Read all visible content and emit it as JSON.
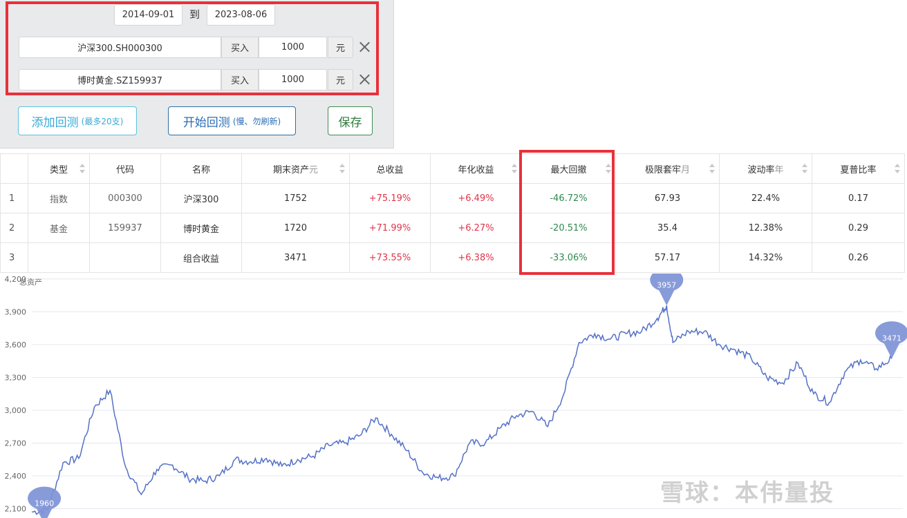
{
  "form": {
    "start_date": "2014-09-01",
    "to_label": "到",
    "end_date": "2023-08-06",
    "rows": [
      {
        "fund": "沪深300.SH000300",
        "action": "买入",
        "amount": "1000",
        "unit": "元"
      },
      {
        "fund": "博时黄金.SZ159937",
        "action": "买入",
        "amount": "1000",
        "unit": "元"
      }
    ],
    "add_label": "添加回测",
    "add_hint": "(最多20支)",
    "start_label": "开始回测",
    "start_hint": "(慢、勿刷新)",
    "save_label": "保存"
  },
  "table": {
    "headers": {
      "type": "类型",
      "code": "代码",
      "name": "名称",
      "final": "期末资产",
      "final_unit": "元",
      "total": "总收益",
      "annual": "年化收益",
      "maxdd": "最大回撤",
      "lock": "极限套牢",
      "lock_unit": "月",
      "vol": "波动率",
      "vol_unit": "年",
      "sharpe": "夏普比率"
    },
    "rows": [
      {
        "idx": "1",
        "type": "指数",
        "code": "000300",
        "name": "沪深300",
        "final": "1752",
        "total": "+75.19%",
        "annual": "+6.49%",
        "maxdd": "-46.72%",
        "lock": "67.93",
        "vol": "22.4%",
        "sharpe": "0.17"
      },
      {
        "idx": "2",
        "type": "基金",
        "code": "159937",
        "name": "博时黄金",
        "final": "1720",
        "total": "+71.99%",
        "annual": "+6.27%",
        "maxdd": "-20.51%",
        "lock": "35.4",
        "vol": "12.38%",
        "sharpe": "0.29"
      },
      {
        "idx": "3",
        "type": "",
        "code": "",
        "name": "组合收益",
        "final": "3471",
        "total": "+73.55%",
        "annual": "+6.38%",
        "maxdd": "-33.06%",
        "lock": "57.17",
        "vol": "14.32%",
        "sharpe": "0.26"
      }
    ]
  },
  "watermark": "雪球：本伟量投",
  "chart_data": {
    "type": "line",
    "ylabel": "总资产",
    "yticks": [
      2100,
      2400,
      2700,
      3000,
      3300,
      3600,
      3900,
      4200
    ],
    "ylim": [
      2015,
      4250
    ],
    "grid": true,
    "color": "#5470c6",
    "markers": [
      {
        "label": "1960",
        "x": 4,
        "y": 1960
      },
      {
        "label": "3957",
        "x": 203,
        "y": 3957
      },
      {
        "label": "3471",
        "x": 275,
        "y": 3471
      }
    ],
    "x": [
      0,
      5,
      10,
      15,
      20,
      25,
      30,
      35,
      40,
      45,
      50,
      55,
      60,
      65,
      70,
      75,
      80,
      85,
      90,
      95,
      100,
      105,
      110,
      115,
      120,
      125,
      130,
      135,
      140,
      145,
      150,
      155,
      160,
      165,
      170,
      175,
      180,
      185,
      190,
      195,
      200,
      203,
      205,
      210,
      215,
      220,
      225,
      230,
      235,
      240,
      245,
      250,
      255,
      260,
      265,
      270,
      275
    ],
    "values": [
      2070,
      2090,
      2520,
      2560,
      3030,
      3180,
      2480,
      2230,
      2460,
      2500,
      2380,
      2350,
      2400,
      2550,
      2530,
      2560,
      2490,
      2550,
      2580,
      2680,
      2700,
      2770,
      2930,
      2780,
      2630,
      2430,
      2380,
      2400,
      2700,
      2700,
      2840,
      2950,
      2990,
      2850,
      3140,
      3620,
      3700,
      3650,
      3700,
      3720,
      3840,
      3957,
      3620,
      3720,
      3720,
      3600,
      3550,
      3480,
      3300,
      3250,
      3430,
      3150,
      3070,
      3350,
      3460,
      3380,
      3471
    ]
  }
}
